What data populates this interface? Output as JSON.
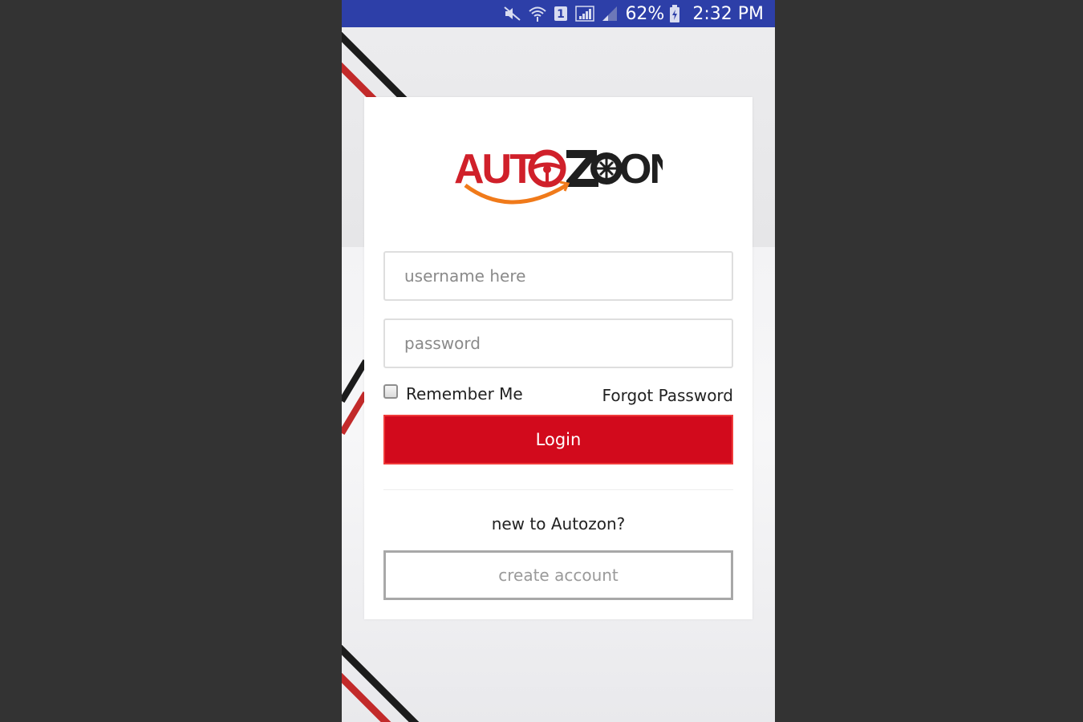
{
  "status_bar": {
    "battery_percent": "62%",
    "time": "2:32 PM",
    "sim_slot": "1",
    "icons": [
      "mute-icon",
      "wifi-icon",
      "sim-icon",
      "signal-icon",
      "signal-weak-icon",
      "battery-charging-icon"
    ]
  },
  "logo": {
    "text_left": "AUT",
    "text_right": "ON",
    "colors": {
      "red": "#d0202a",
      "dark": "#1f1f1f",
      "orange": "#f07a1a"
    }
  },
  "login_form": {
    "username_placeholder": "username here",
    "password_placeholder": "password",
    "remember_label": "Remember Me",
    "remember_checked": false,
    "forgot_label": "Forgot Password",
    "login_label": "Login",
    "new_prompt": "new to Autozon?",
    "create_label": "create account"
  },
  "colors": {
    "status_bar": "#2d3fa8",
    "login_button": "#d20a1c",
    "stripe_red": "#c22a2a",
    "stripe_dark": "#1c1c1c"
  }
}
